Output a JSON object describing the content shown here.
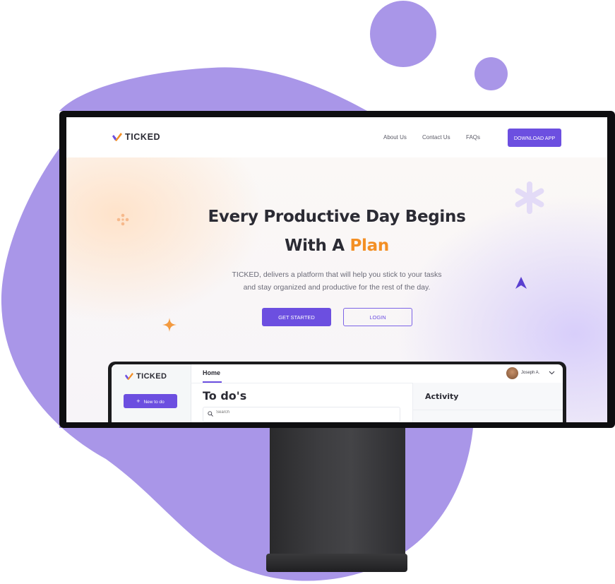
{
  "brand": {
    "name": "TICKED"
  },
  "nav": {
    "links": [
      "About Us",
      "Contact Us",
      "FAQs"
    ],
    "download_label": "DOWNLOAD APP"
  },
  "hero": {
    "title_line1": "Every Productive Day Begins",
    "title_line2_prefix": "With A ",
    "title_line2_highlight": "Plan",
    "subtitle_line1": "TICKED, delivers a platform that will help you stick to your tasks",
    "subtitle_line2": "and stay organized and productive for the rest of the day.",
    "primary_cta": "GET STARTED",
    "secondary_cta": "LOGIN"
  },
  "app_preview": {
    "brand": "TICKED",
    "new_button_label": "New to do",
    "new_button_icon": "+",
    "tab": "Home",
    "user_name": "Joseph A.",
    "page_title": "To do's",
    "search_placeholder": "Search",
    "panel_title": "Activity"
  },
  "colors": {
    "accent": "#6c4fe0",
    "highlight": "#f38f24",
    "blob": "#a996e8",
    "text_dark": "#2b2b34"
  }
}
